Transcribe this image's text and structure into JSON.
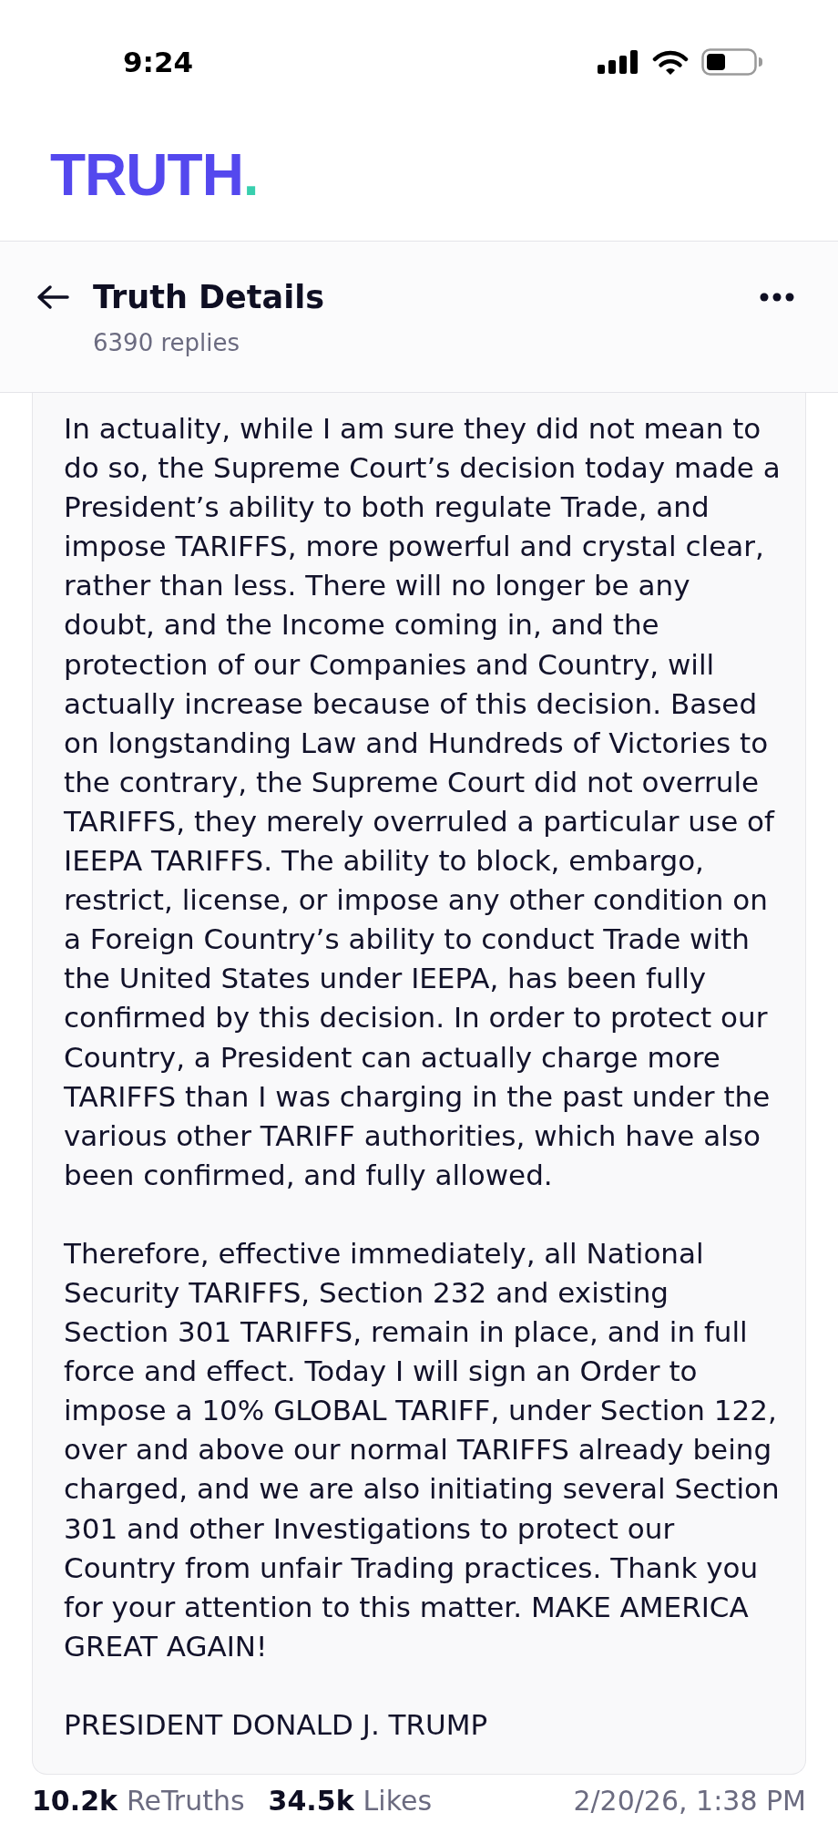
{
  "status_bar": {
    "time": "9:24"
  },
  "logo": {
    "text": "TRUTH."
  },
  "header": {
    "title": "Truth Details",
    "subtitle": "6390 replies"
  },
  "post": {
    "paragraphs": [
      "In actuality, while I am sure they did not mean to do so, the Supreme Court’s decision today made a President’s ability to both regulate Trade, and impose TARIFFS, more powerful and crystal clear, rather than less. There will no longer be any doubt, and the Income coming in, and the protection of our Companies and Country, will actually increase because of this decision. Based on longstanding Law and Hundreds of Victories to the contrary, the Supreme Court did not overrule TARIFFS, they merely overruled a particular use of IEEPA TARIFFS. The ability to block, embargo, restrict, license, or impose any other condition on a Foreign Country’s ability to conduct Trade with the United States under IEEPA, has been fully confirmed by this decision. In order to protect our Country, a President can actually charge more TARIFFS than I was charging in the past under the various other TARIFF authorities, which have also been confirmed, and fully allowed.",
      "Therefore, effective immediately, all National Security TARIFFS, Section 232 and existing Section 301 TARIFFS, remain in place, and in full force and effect. Today I will sign an Order to impose a 10% GLOBAL TARIFF, under Section 122, over and above our normal TARIFFS already being charged, and we are also initiating several Section 301 and other Investigations to protect our Country from unfair Trading practices. Thank you for your attention to this matter. MAKE AMERICA GREAT AGAIN!",
      "PRESIDENT DONALD J. TRUMP"
    ]
  },
  "stats": {
    "counters": [
      {
        "count": "10.2k",
        "label": "ReTruths"
      },
      {
        "count": "34.5k",
        "label": "Likes"
      }
    ],
    "timestamp": "2/20/26, 1:38 PM"
  }
}
